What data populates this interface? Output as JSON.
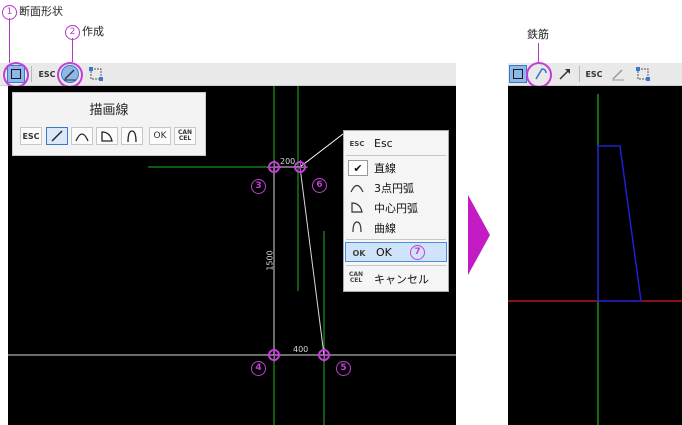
{
  "callouts": {
    "section_shape": {
      "num": "1",
      "label": "断面形状"
    },
    "create": {
      "num": "2",
      "label": "作成"
    },
    "rebar": {
      "label": "鉄筋"
    }
  },
  "left_toolbar": {
    "esc_label": "ESC"
  },
  "right_toolbar": {
    "esc_label": "ESC"
  },
  "palette": {
    "title": "描画線",
    "buttons": [
      {
        "name": "esc",
        "label": "ESC"
      },
      {
        "name": "line",
        "icon": "line-icon"
      },
      {
        "name": "arc3",
        "icon": "arc3-icon"
      },
      {
        "name": "center-arc",
        "icon": "center-arc-icon"
      },
      {
        "name": "curve",
        "icon": "curve-icon"
      },
      {
        "name": "ok",
        "label": "OK"
      },
      {
        "name": "cancel",
        "label": "CAN\nCEL"
      }
    ]
  },
  "menu": {
    "items": [
      {
        "icon_label": "ESC",
        "label": "Esc"
      },
      {
        "icon": "check-icon",
        "label": "直線"
      },
      {
        "icon": "arc3-icon",
        "label": "3点円弧"
      },
      {
        "icon": "center-arc-icon",
        "label": "中心円弧"
      },
      {
        "icon": "curve-icon",
        "label": "曲線"
      },
      {
        "icon_label": "OK",
        "label": "OK",
        "badge": "7"
      },
      {
        "icon_label": "CAN CEL",
        "label": "キャンセル"
      }
    ]
  },
  "canvas": {
    "dims": {
      "top": "200",
      "vertical": "1500",
      "bottom": "400"
    },
    "markers": [
      "3",
      "4",
      "5",
      "6"
    ]
  },
  "colors": {
    "accent": "#c33fd6",
    "selected": "#8fb8ea",
    "axis_green": "#1bb51b",
    "axis_red": "#d81e1e",
    "shape_blue": "#1f1fd6"
  }
}
